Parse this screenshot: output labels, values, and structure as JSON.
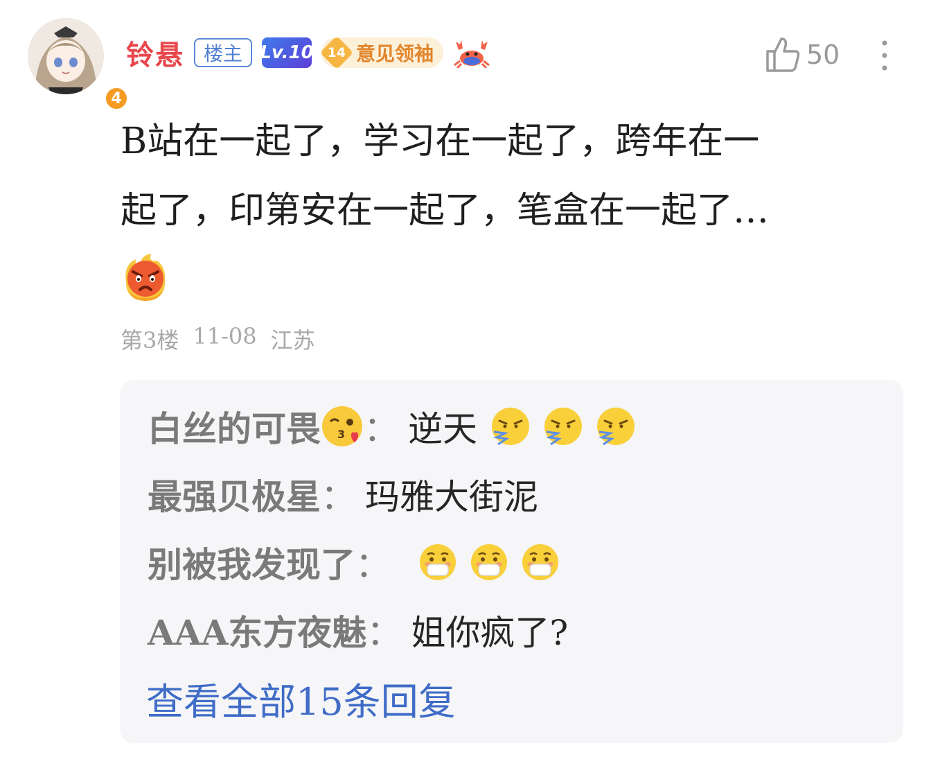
{
  "comment": {
    "avatar_level": "4",
    "username": "铃悬",
    "op_tag": "楼主",
    "level_badge": "Lv.10",
    "fan_badge_level": "14",
    "fan_badge_title": "意见领袖",
    "like_count": "50",
    "content_lines": [
      "B站在一起了，学习在一起了，跨年在一",
      "起了，印第安在一起了，笔盒在一起了…"
    ],
    "content_emoji": "angry-fire-emoji",
    "floor": "第3楼",
    "date": "11-08",
    "location": "江苏"
  },
  "replies": [
    {
      "user": "白丝的可畏",
      "user_emoji": "kiss-wink-emoji",
      "sep": "：",
      "text": "逆天",
      "emojis": [
        "snort-emoji",
        "snort-emoji",
        "snort-emoji"
      ]
    },
    {
      "user": "最强贝极星",
      "sep": "：",
      "text": "玛雅大街泥",
      "emojis": []
    },
    {
      "user": "别被我发现了",
      "sep": "：",
      "text": "",
      "emojis": [
        "mask-emoji",
        "mask-emoji",
        "mask-emoji"
      ]
    },
    {
      "user": "AAA东方夜魅",
      "sep": "：",
      "text": "姐你疯了?",
      "emojis": []
    }
  ],
  "view_all_replies": "查看全部15条回复",
  "colors": {
    "username": "#e8474c",
    "link": "#3f6cc7",
    "meta": "#a8a8a8",
    "reply_bg": "#f6f6f8"
  }
}
